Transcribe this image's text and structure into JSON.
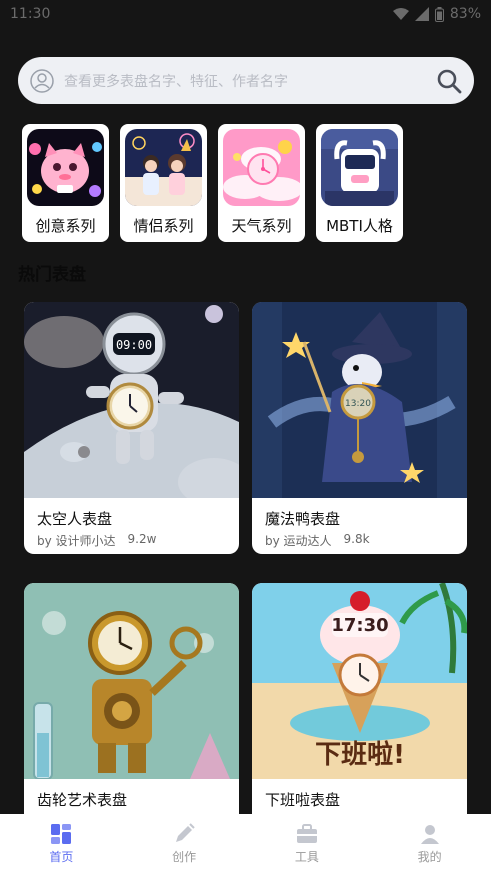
{
  "status_bar": {
    "time": "11:30",
    "battery": "83%"
  },
  "search": {
    "placeholder": "查看更多表盘名字、特征、作者名字",
    "icon": "search-icon",
    "avatar_icon": "user-avatar-icon"
  },
  "series": [
    {
      "label": "创意系列"
    },
    {
      "label": "情侣系列"
    },
    {
      "label": "天气系列"
    },
    {
      "label": "MBTI人格"
    }
  ],
  "section_title": "热门表盘",
  "dials": [
    {
      "title": "太空人表盘",
      "author": "by 设计师小达",
      "count": "9.2w",
      "clock_text": "09:00"
    },
    {
      "title": "魔法鸭表盘",
      "author": "by 运动达人",
      "count": "9.8k",
      "clock_text": "13:20"
    },
    {
      "title": "齿轮艺术表盘",
      "author": "",
      "count": "",
      "clock_text": ""
    },
    {
      "title": "下班啦表盘",
      "author": "",
      "count": "",
      "clock_text": "17:30",
      "banner_text": "下班啦!"
    }
  ],
  "nav": [
    {
      "label": "首页",
      "icon": "home-dashboard-icon",
      "active": true
    },
    {
      "label": "创作",
      "icon": "pen-icon",
      "active": false
    },
    {
      "label": "工具",
      "icon": "toolbox-icon",
      "active": false
    },
    {
      "label": "我的",
      "icon": "profile-icon",
      "active": false
    }
  ],
  "colors": {
    "accent": "#5b6cf0",
    "background": "#151515",
    "card": "#ffffff"
  }
}
